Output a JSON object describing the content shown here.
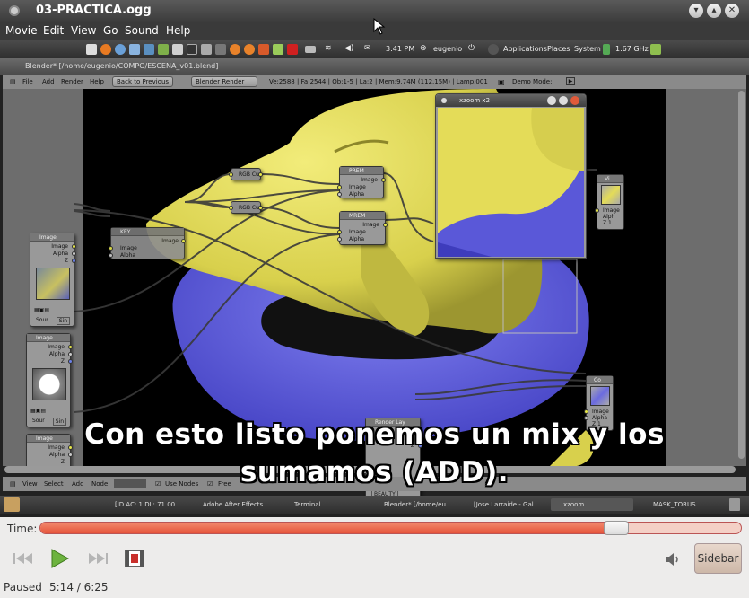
{
  "window": {
    "title": "03-PRACTICA.ogg"
  },
  "menu": [
    "Movie",
    "Edit",
    "View",
    "Go",
    "Sound",
    "Help"
  ],
  "gnome_panel": {
    "clock": "3:41 PM",
    "user": "eugenio",
    "menus": [
      "Applications",
      "Places",
      "System"
    ],
    "cpu": "1.67 GHz"
  },
  "blender": {
    "title": "Blender* [/home/eugenio/COMPO/ESCENA_v01.blend]",
    "header_menus": [
      "File",
      "Add",
      "Render",
      "Help"
    ],
    "back_button": "Back to Previous",
    "render_engine": "Blender Render",
    "stats": "Ve:2588 | Fa:2544 | Ob:1-5 | La:2 | Mem:9.74M (112.15M) | Lamp.001",
    "demo_mode": "Demo Mode:",
    "footer": [
      "View",
      "Select",
      "Add",
      "Node"
    ],
    "use_nodes": "Use Nodes",
    "free_label": "Free"
  },
  "nodes": {
    "image": {
      "title": "Image",
      "out1": "Image",
      "out2": "Alpha",
      "out3": "Z",
      "sour": "Sour",
      "sin": "Sin"
    },
    "key": {
      "title": "KEY",
      "out": "Image",
      "in1": "Image",
      "in2": "Alpha"
    },
    "rgb": "RGB Cu",
    "prem": {
      "title": "PREM",
      "out": "Image",
      "in1": "Image",
      "in2": "Alpha"
    },
    "mrem": {
      "title": "MREM",
      "out": "Image",
      "in1": "Image",
      "in2": "Alpha"
    },
    "viewer": {
      "title": "Vi",
      "in1": "Image",
      "in2": "Alph",
      "in3": "Z 1"
    },
    "composite": {
      "title": "Co",
      "in1": "Image",
      "in2": "Alpha",
      "in3": "Z 1"
    },
    "render_layer": {
      "title": "Render Lay",
      "out1": "Image",
      "out2": "Alpha",
      "out3": "Z",
      "layer": "BEAUTY"
    }
  },
  "xzoom": {
    "title": "xzoom x2"
  },
  "taskbar": [
    "[ID AC: 1 DL: 71.00 ...",
    "Adobe After Effects ...",
    "Terminal",
    "Blender* [/home/eu...",
    "[Jose Larraide - Gal...",
    "xzoom",
    "MASK_TORUS"
  ],
  "subtitle": {
    "line1": "Con esto listo ponemos un mix y los",
    "line2": "sumamos (ADD)."
  },
  "player": {
    "time_label": "Time:",
    "progress": 0.822,
    "sidebar_label": "Sidebar",
    "status": "Paused",
    "position": "5:14 / 6:25"
  },
  "colors": {
    "seek": "#e5543a",
    "yellow": "#e4dc58",
    "blue": "#6b6be0"
  }
}
